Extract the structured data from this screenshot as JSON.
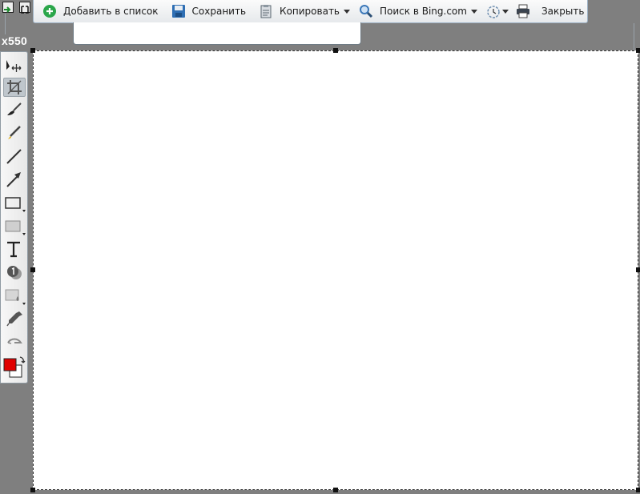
{
  "toolbar": {
    "add_to_list": "Добавить в список",
    "save": "Сохранить",
    "copy": "Копировать",
    "search": "Поиск в Bing.com",
    "close": "Закрыть"
  },
  "canvas": {
    "size_label": "x550"
  },
  "colors": {
    "foreground": "#e00000",
    "background": "#ffffff",
    "workspace": "#7f7f7f",
    "add_icon": "#2aa64a",
    "save_icon": "#2f6fb4",
    "search_icon": "#3c78b8"
  },
  "tools": [
    "select-move-icon",
    "crop-icon",
    "brush-icon",
    "pen-icon",
    "line-icon",
    "arrow-icon",
    "rectangle-icon",
    "filled-rectangle-icon",
    "text-icon",
    "step-number-icon",
    "blur-icon",
    "eyedropper-icon",
    "undo-icon",
    "color-swatch-icon"
  ]
}
